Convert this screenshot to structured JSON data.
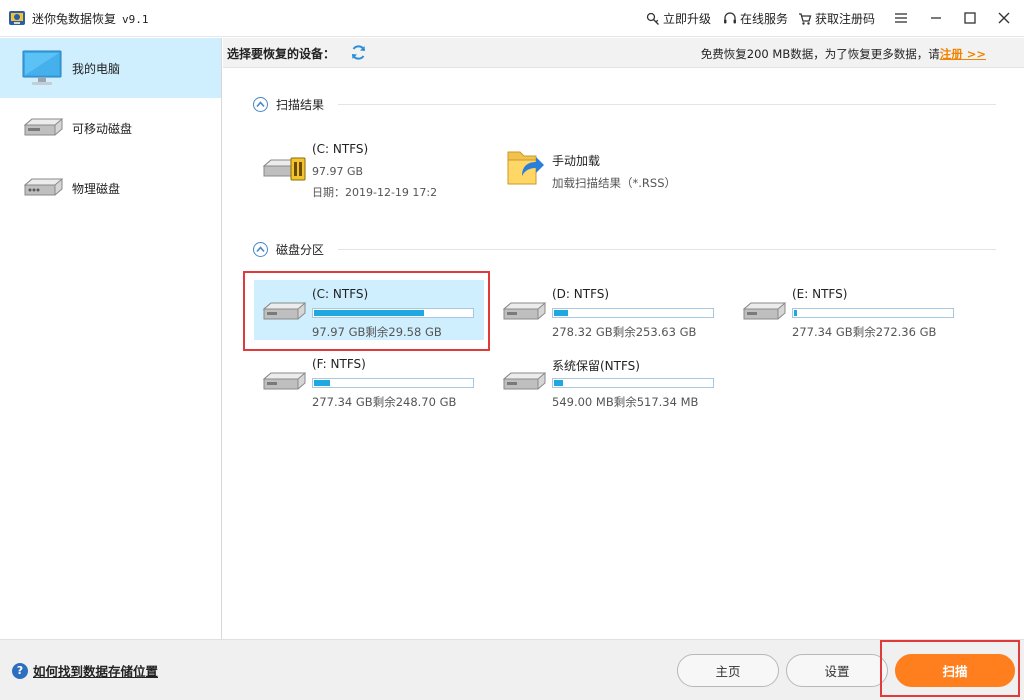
{
  "window": {
    "title": "迷你兔数据恢复",
    "version": "v9.1",
    "links": [
      "立即升级",
      "在线服务",
      "获取注册码"
    ]
  },
  "sidebar": {
    "items": [
      {
        "label": "我的电脑",
        "active": true
      },
      {
        "label": "可移动磁盘",
        "active": false
      },
      {
        "label": "物理磁盘",
        "active": false
      }
    ]
  },
  "header": {
    "select_label": "选择要恢复的设备：",
    "notice": "免费恢复200 MB数据，为了恢复更多数据，请",
    "register_link": "注册 >>"
  },
  "scan_results": {
    "title": "扫描结果",
    "items": [
      {
        "name": "(C: NTFS)",
        "size": "97.97 GB",
        "date": "日期：2019-12-19 17:2"
      },
      {
        "name": "手动加载",
        "desc": "加载扫描结果（*.RSS）"
      }
    ]
  },
  "partitions": {
    "title": "磁盘分区",
    "items": [
      {
        "name": "(C: NTFS)",
        "size": "97.97 GB剩余29.58 GB",
        "used": 0.698,
        "selected": true
      },
      {
        "name": "(D: NTFS)",
        "size": "278.32 GB剩余253.63 GB",
        "used": 0.089,
        "selected": false
      },
      {
        "name": "(E: NTFS)",
        "size": "277.34 GB剩余272.36 GB",
        "used": 0.018,
        "selected": false
      },
      {
        "name": "(F: NTFS)",
        "size": "277.34 GB剩余248.70 GB",
        "used": 0.103,
        "selected": false
      },
      {
        "name": "系统保留(NTFS)",
        "size": "549.00 MB剩余517.34 MB",
        "used": 0.058,
        "selected": false
      }
    ]
  },
  "footer": {
    "help": "如何找到数据存储位置",
    "home": "主页",
    "settings": "设置",
    "scan": "扫描"
  },
  "colors": {
    "accent": "#ff7f1e",
    "selected_bg": "#cfeefe",
    "bar_fill": "#1fa7e0",
    "highlight": "#e03a3a"
  }
}
